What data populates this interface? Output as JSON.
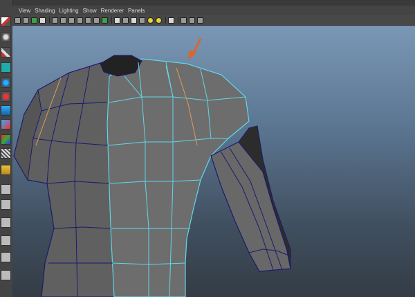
{
  "menu": {
    "items": [
      "View",
      "Shading",
      "Lighting",
      "Show",
      "Renderer",
      "Panels"
    ]
  },
  "colors": {
    "selected_wire": "#5fd8e8",
    "seam_edges": "#e39c5a",
    "arrow": "#e0642a",
    "mesh_fill": "#6b6b6b"
  },
  "icons": {
    "toolbox": [
      "select-arrow-icon",
      "lasso-icon",
      "paint-brush-icon",
      "cone-icon",
      "sphere-icon",
      "rotate-icon",
      "scale-icon",
      "cube-icon",
      "move-icon",
      "wireframe-icon",
      "layout-icon",
      "layout-icon",
      "layout-icon",
      "layout-icon",
      "layout-icon"
    ],
    "annotation": "arrow-pointer-icon"
  }
}
